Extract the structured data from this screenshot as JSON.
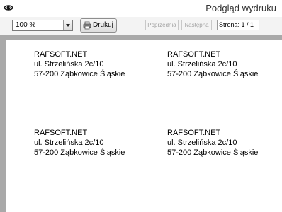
{
  "window": {
    "title": "Podgląd wydruku"
  },
  "toolbar": {
    "zoom_value": "100 %",
    "print_label": "Drukuj",
    "prev_label": "Poprzednia",
    "next_label": "Następna",
    "page_indicator": "Strona: 1 / 1"
  },
  "labels": [
    {
      "company": "RAFSOFT.NET",
      "street": "ul. Strzelińska 2c/10",
      "city": "57-200 Ząbkowice Śląskie"
    },
    {
      "company": "RAFSOFT.NET",
      "street": "ul. Strzelińska 2c/10",
      "city": "57-200 Ząbkowice Śląskie"
    },
    {
      "company": "RAFSOFT.NET",
      "street": "ul. Strzelińska 2c/10",
      "city": "57-200 Ząbkowice Śląskie"
    },
    {
      "company": "RAFSOFT.NET",
      "street": "ul. Strzelińska 2c/10",
      "city": "57-200 Ząbkowice Śląskie"
    }
  ],
  "icons": {
    "app": "eye-icon",
    "print": "printer-icon",
    "dropdown": "chevron-down-icon"
  }
}
